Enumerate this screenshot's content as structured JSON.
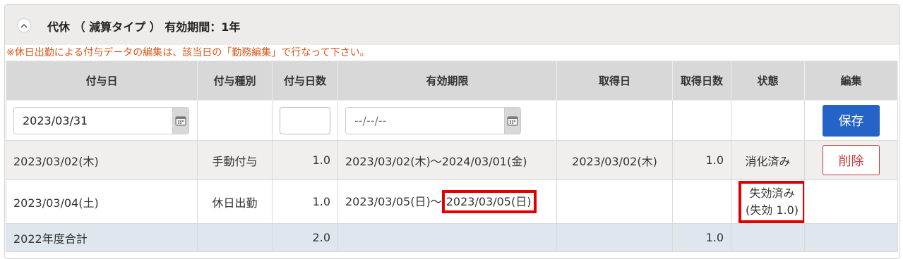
{
  "panel": {
    "title": "代休 （ 減算タイプ ） 有効期間：1年",
    "notice": "※休日出勤による付与データの編集は、該当日の「勤務編集」で行なって下さい。"
  },
  "columns": [
    "付与日",
    "付与種別",
    "付与日数",
    "有効期限",
    "取得日",
    "取得日数",
    "状態",
    "編集"
  ],
  "input_row": {
    "grant_date_value": "2023/03/31",
    "days_value": "",
    "expiry_placeholder": "--/--/--",
    "save_label": "保存"
  },
  "rows": [
    {
      "grant_date": "2023/03/02(木)",
      "type": "手動付与",
      "days": "1.0",
      "expiry_start": "2023/03/02(木)",
      "expiry_sep": "～",
      "expiry_end": "2024/03/01(金)",
      "acquired_date": "2023/03/02(木)",
      "acquired_days": "1.0",
      "status": "消化済み",
      "delete_label": "削除"
    },
    {
      "grant_date": "2023/03/04(土)",
      "type": "休日出勤",
      "days": "1.0",
      "expiry_start": "2023/03/05(日)",
      "expiry_sep": "～",
      "expiry_end": "2023/03/05(日)",
      "acquired_date": "",
      "acquired_days": "",
      "status_line1": "失効済み",
      "status_line2": "(失効 1.0)"
    }
  ],
  "total": {
    "label": "2022年度合計",
    "days": "2.0",
    "acquired_days": "1.0"
  },
  "colors": {
    "highlight": "#e00000",
    "save_button": "#2563c7",
    "delete_button": "#c43d3d",
    "notice": "#d9541a"
  }
}
